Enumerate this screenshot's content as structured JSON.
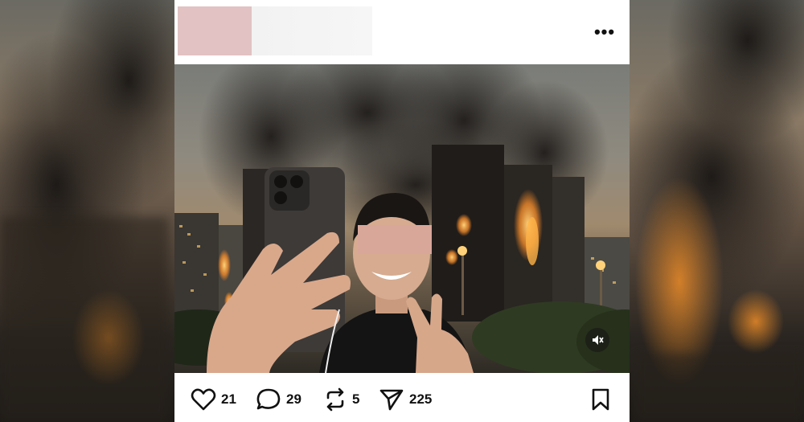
{
  "post": {
    "more_label": "•••",
    "stats": {
      "likes": "21",
      "comments": "29",
      "reposts": "5",
      "shares": "225"
    },
    "icons": {
      "like": "heart-icon",
      "comment": "comment-bubble-icon",
      "repost": "repost-icon",
      "share": "send-icon",
      "save": "bookmark-icon",
      "mute": "speaker-muted-icon",
      "more": "more-horizontal-icon"
    },
    "colors": {
      "avatar_redaction": "#e2c2c3",
      "name_redaction": "#f2f2f2",
      "face_redaction": "#d9a79a",
      "fire": "#f0892a"
    }
  }
}
